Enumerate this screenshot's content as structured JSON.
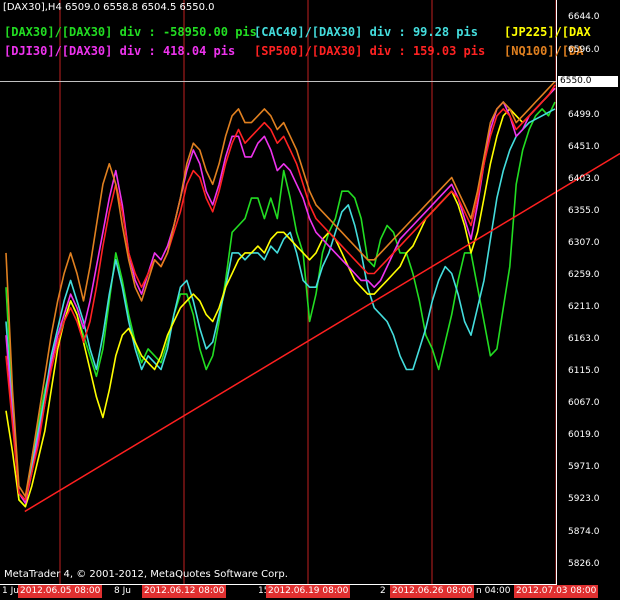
{
  "window": {
    "symbol_title": "[DAX30],H4  6509.0 6558.8 6504.5 6550.0",
    "copyright": "MetaTrader 4, © 2001-2012, MetaQuotes Software Corp."
  },
  "chart_data": {
    "type": "line",
    "title": "[DAX30],H4  6509.0 6558.8 6504.5 6550.0",
    "ylim": [
      5826.0,
      6644.0
    ],
    "grid": false,
    "current_price": "6550.0",
    "y_ticks": [
      "6644.0",
      "6596.0",
      "6499.0",
      "6451.0",
      "6403.0",
      "6355.0",
      "6307.0",
      "6259.0",
      "6211.0",
      "6163.0",
      "6115.0",
      "6067.0",
      "6019.0",
      "5971.0",
      "5923.0",
      "5874.0",
      "5826.0"
    ],
    "x_ticks": [
      "1 Ju",
      "8 Ju",
      "15",
      "2",
      "n 04:00"
    ],
    "date_markers": [
      "2012.06.05 08:00",
      "2012.06.12 08:00",
      "2012.06.19 08:00",
      "2012.06.26 08:00",
      "2012.07.03 08:00"
    ],
    "divergence_labels": [
      {
        "text": "[DAX30]/[DAX30] div : -58950.00 pis",
        "color": "#22dd22"
      },
      {
        "text": "[CAC40]/[DAX30] div : 99.28 pis",
        "color": "#44dddd"
      },
      {
        "text": "[JP225]/[DAX",
        "color": "#ffff00"
      },
      {
        "text": "[DJI30]/[DAX30] div : 418.04 pis",
        "color": "#ee33ee"
      },
      {
        "text": "[SP500]/[DAX30] div : 159.03 pis",
        "color": "#ff2222"
      },
      {
        "text": "[NQ100]/[DA",
        "color": "#e08020"
      }
    ],
    "trendline": {
      "start": [
        0.04,
        5923
      ],
      "end": [
        1.0,
        6445
      ],
      "color": "#ff2020"
    },
    "series": [
      {
        "name": "[DAX30]",
        "color": "#22dd22",
        "values": [
          6250,
          6080,
          5940,
          5930,
          6000,
          6050,
          6100,
          6140,
          6180,
          6200,
          6230,
          6210,
          6180,
          6150,
          6120,
          6160,
          6230,
          6300,
          6260,
          6210,
          6170,
          6140,
          6160,
          6150,
          6140,
          6170,
          6210,
          6240,
          6240,
          6210,
          6160,
          6130,
          6150,
          6200,
          6260,
          6330,
          6340,
          6350,
          6380,
          6380,
          6350,
          6380,
          6350,
          6420,
          6380,
          6330,
          6300,
          6200,
          6240,
          6300,
          6330,
          6350,
          6390,
          6390,
          6380,
          6350,
          6290,
          6280,
          6320,
          6340,
          6330,
          6300,
          6300,
          6270,
          6230,
          6180,
          6160,
          6130,
          6170,
          6210,
          6260,
          6300,
          6300,
          6250,
          6200,
          6150,
          6160,
          6220,
          6280,
          6400,
          6450,
          6480,
          6500,
          6510,
          6500,
          6520
        ]
      },
      {
        "name": "[CAC40]",
        "color": "#44dddd",
        "values": [
          6200,
          6070,
          5950,
          5940,
          5990,
          6040,
          6090,
          6150,
          6190,
          6230,
          6260,
          6230,
          6200,
          6160,
          6130,
          6180,
          6240,
          6290,
          6250,
          6200,
          6160,
          6130,
          6150,
          6140,
          6130,
          6160,
          6210,
          6250,
          6260,
          6230,
          6190,
          6160,
          6170,
          6210,
          6250,
          6300,
          6300,
          6290,
          6300,
          6300,
          6290,
          6310,
          6300,
          6320,
          6330,
          6300,
          6260,
          6250,
          6250,
          6280,
          6300,
          6330,
          6360,
          6370,
          6340,
          6300,
          6250,
          6220,
          6210,
          6200,
          6180,
          6150,
          6130,
          6130,
          6160,
          6190,
          6230,
          6260,
          6280,
          6270,
          6240,
          6200,
          6180,
          6220,
          6260,
          6320,
          6380,
          6420,
          6450,
          6470,
          6480,
          6490,
          6495,
          6500,
          6505,
          6510
        ]
      },
      {
        "name": "[JP225]",
        "color": "#ffff00",
        "values": [
          6070,
          6010,
          5940,
          5930,
          5960,
          6000,
          6040,
          6100,
          6160,
          6200,
          6230,
          6210,
          6170,
          6130,
          6090,
          6060,
          6100,
          6150,
          6180,
          6190,
          6170,
          6150,
          6140,
          6130,
          6150,
          6180,
          6200,
          6220,
          6230,
          6240,
          6230,
          6210,
          6200,
          6220,
          6250,
          6270,
          6290,
          6300,
          6300,
          6310,
          6300,
          6320,
          6330,
          6330,
          6320,
          6310,
          6300,
          6290,
          6300,
          6320,
          6330,
          6320,
          6300,
          6280,
          6260,
          6250,
          6240,
          6240,
          6250,
          6260,
          6270,
          6280,
          6300,
          6310,
          6330,
          6350,
          6360,
          6370,
          6380,
          6390,
          6370,
          6340,
          6300,
          6330,
          6380,
          6430,
          6470,
          6500,
          6510,
          6500,
          6490,
          6500,
          6510,
          6520,
          6530,
          6540
        ]
      },
      {
        "name": "[DJI30]",
        "color": "#ee33ee",
        "values": [
          6180,
          6060,
          5950,
          5935,
          5980,
          6030,
          6080,
          6140,
          6180,
          6210,
          6240,
          6220,
          6190,
          6230,
          6280,
          6330,
          6380,
          6420,
          6370,
          6300,
          6260,
          6240,
          6270,
          6300,
          6290,
          6310,
          6340,
          6380,
          6420,
          6450,
          6430,
          6390,
          6370,
          6400,
          6440,
          6470,
          6470,
          6440,
          6440,
          6460,
          6470,
          6450,
          6420,
          6430,
          6420,
          6400,
          6380,
          6350,
          6330,
          6320,
          6310,
          6300,
          6290,
          6280,
          6270,
          6260,
          6260,
          6250,
          6260,
          6280,
          6300,
          6320,
          6330,
          6340,
          6350,
          6360,
          6370,
          6380,
          6390,
          6400,
          6380,
          6350,
          6320,
          6370,
          6430,
          6480,
          6510,
          6520,
          6500,
          6470,
          6480,
          6500,
          6510,
          6520,
          6530,
          6540
        ]
      },
      {
        "name": "[SP500]",
        "color": "#ff2222",
        "values": [
          6150,
          6050,
          5950,
          5940,
          5980,
          6020,
          6080,
          6130,
          6170,
          6200,
          6220,
          6200,
          6170,
          6200,
          6250,
          6310,
          6360,
          6400,
          6360,
          6300,
          6270,
          6250,
          6270,
          6290,
          6280,
          6300,
          6330,
          6360,
          6400,
          6420,
          6410,
          6380,
          6360,
          6390,
          6430,
          6460,
          6480,
          6460,
          6470,
          6480,
          6490,
          6480,
          6460,
          6470,
          6450,
          6430,
          6400,
          6370,
          6350,
          6340,
          6330,
          6320,
          6310,
          6300,
          6290,
          6280,
          6270,
          6270,
          6280,
          6290,
          6300,
          6310,
          6320,
          6330,
          6340,
          6350,
          6360,
          6370,
          6380,
          6390,
          6380,
          6360,
          6340,
          6380,
          6430,
          6470,
          6500,
          6510,
          6500,
          6480,
          6490,
          6500,
          6510,
          6520,
          6530,
          6545
        ]
      },
      {
        "name": "[NQ100]",
        "color": "#e08020",
        "values": [
          6300,
          6100,
          5960,
          5945,
          6000,
          6060,
          6120,
          6180,
          6230,
          6270,
          6300,
          6270,
          6230,
          6280,
          6340,
          6400,
          6430,
          6400,
          6340,
          6290,
          6250,
          6230,
          6260,
          6290,
          6280,
          6300,
          6340,
          6380,
          6430,
          6460,
          6450,
          6420,
          6400,
          6430,
          6470,
          6500,
          6510,
          6490,
          6490,
          6500,
          6510,
          6500,
          6480,
          6490,
          6470,
          6450,
          6420,
          6390,
          6370,
          6360,
          6350,
          6340,
          6330,
          6320,
          6310,
          6300,
          6290,
          6290,
          6300,
          6310,
          6320,
          6330,
          6340,
          6350,
          6360,
          6370,
          6380,
          6390,
          6400,
          6410,
          6390,
          6370,
          6350,
          6390,
          6440,
          6490,
          6510,
          6520,
          6510,
          6490,
          6500,
          6510,
          6520,
          6530,
          6540,
          6550
        ]
      }
    ]
  }
}
